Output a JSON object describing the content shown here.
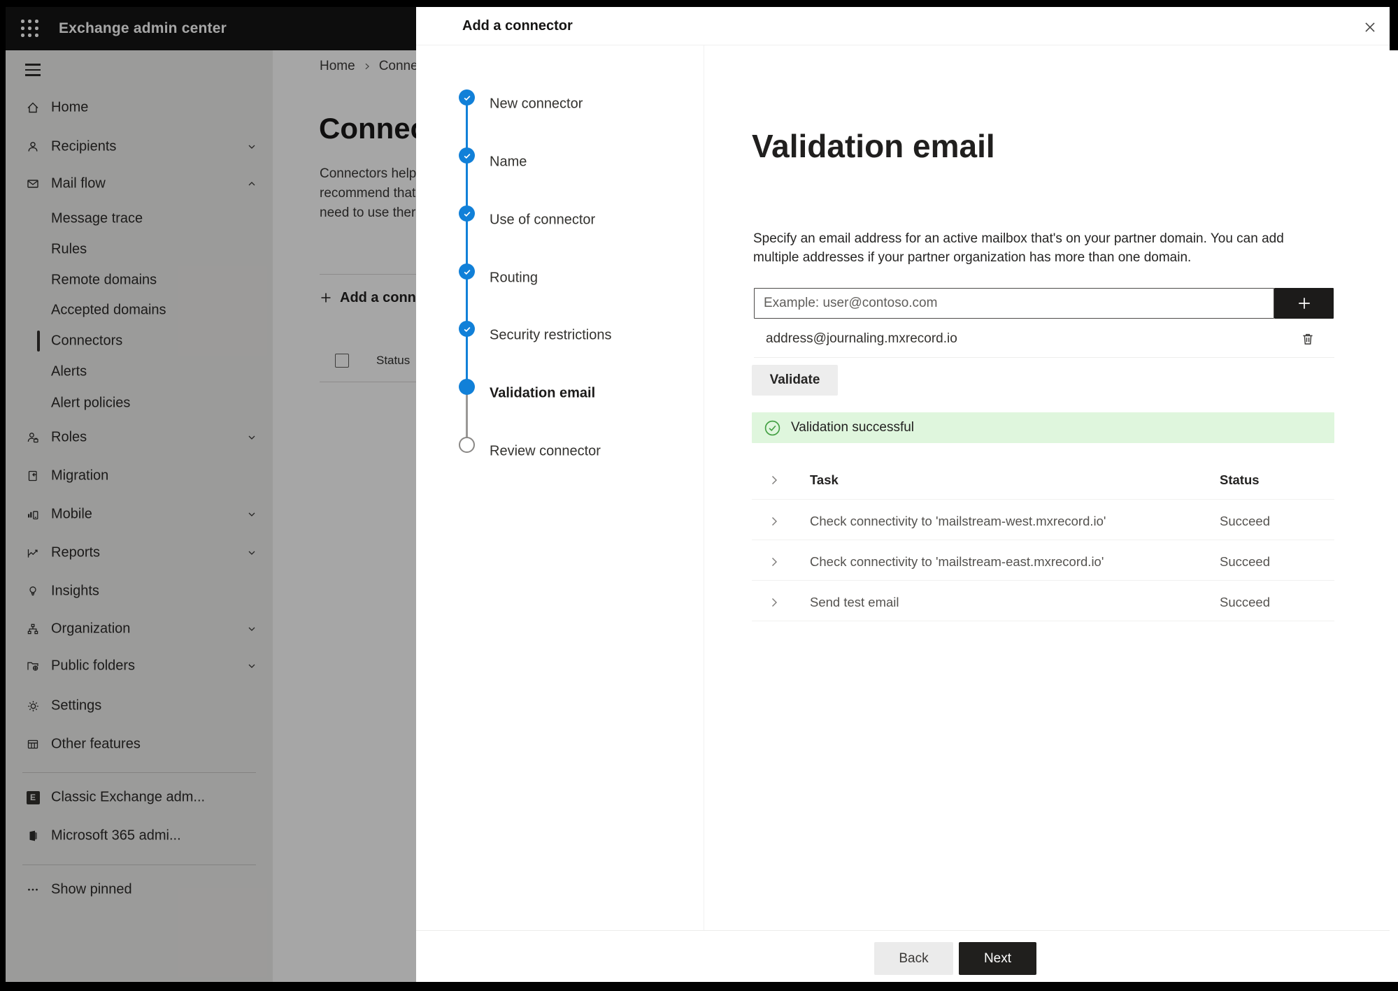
{
  "topbar": {
    "title": "Exchange admin center"
  },
  "bg": {
    "breadcrumb": {
      "home": "Home",
      "current": "Conne"
    },
    "title": "Connec",
    "intro": [
      "Connectors help",
      "recommend that",
      "need to use ther"
    ],
    "add_button": "Add a conn",
    "status_header": "Status"
  },
  "sidebar": {
    "items": [
      {
        "label": "Home"
      },
      {
        "label": "Recipients"
      },
      {
        "label": "Mail flow"
      },
      {
        "label": "Message trace"
      },
      {
        "label": "Rules"
      },
      {
        "label": "Remote domains"
      },
      {
        "label": "Accepted domains"
      },
      {
        "label": "Connectors"
      },
      {
        "label": "Alerts"
      },
      {
        "label": "Alert policies"
      },
      {
        "label": "Roles"
      },
      {
        "label": "Migration"
      },
      {
        "label": "Mobile"
      },
      {
        "label": "Reports"
      },
      {
        "label": "Insights"
      },
      {
        "label": "Organization"
      },
      {
        "label": "Public folders"
      },
      {
        "label": "Settings"
      },
      {
        "label": "Other features"
      },
      {
        "label": "Classic Exchange adm..."
      },
      {
        "label": "Microsoft 365 admi..."
      },
      {
        "label": "Show pinned"
      }
    ]
  },
  "panel": {
    "title": "Add a connector",
    "steps": [
      {
        "label": "New connector",
        "state": "done"
      },
      {
        "label": "Name",
        "state": "done"
      },
      {
        "label": "Use of connector",
        "state": "done"
      },
      {
        "label": "Routing",
        "state": "done"
      },
      {
        "label": "Security restrictions",
        "state": "done"
      },
      {
        "label": "Validation email",
        "state": "current"
      },
      {
        "label": "Review connector",
        "state": "todo"
      }
    ],
    "heading": "Validation email",
    "description": "Specify an email address for an active mailbox that's on your partner domain. You can add multiple addresses if your partner organization has more than one domain.",
    "input_placeholder": "Example: user@contoso.com",
    "address": "address@journaling.mxrecord.io",
    "validate_label": "Validate",
    "banner_text": "Validation successful",
    "table": {
      "task_header": "Task",
      "status_header": "Status",
      "rows": [
        {
          "task": "Check connectivity to 'mailstream-west.mxrecord.io'",
          "status": "Succeed"
        },
        {
          "task": "Check connectivity to 'mailstream-east.mxrecord.io'",
          "status": "Succeed"
        },
        {
          "task": "Send test email",
          "status": "Succeed"
        }
      ]
    },
    "back_label": "Back",
    "next_label": "Next"
  },
  "colors": {
    "accent_blue": "#1180d8",
    "success_bg": "#dff6dd",
    "success_green": "#44a044",
    "topbar_bg": "#141414"
  }
}
